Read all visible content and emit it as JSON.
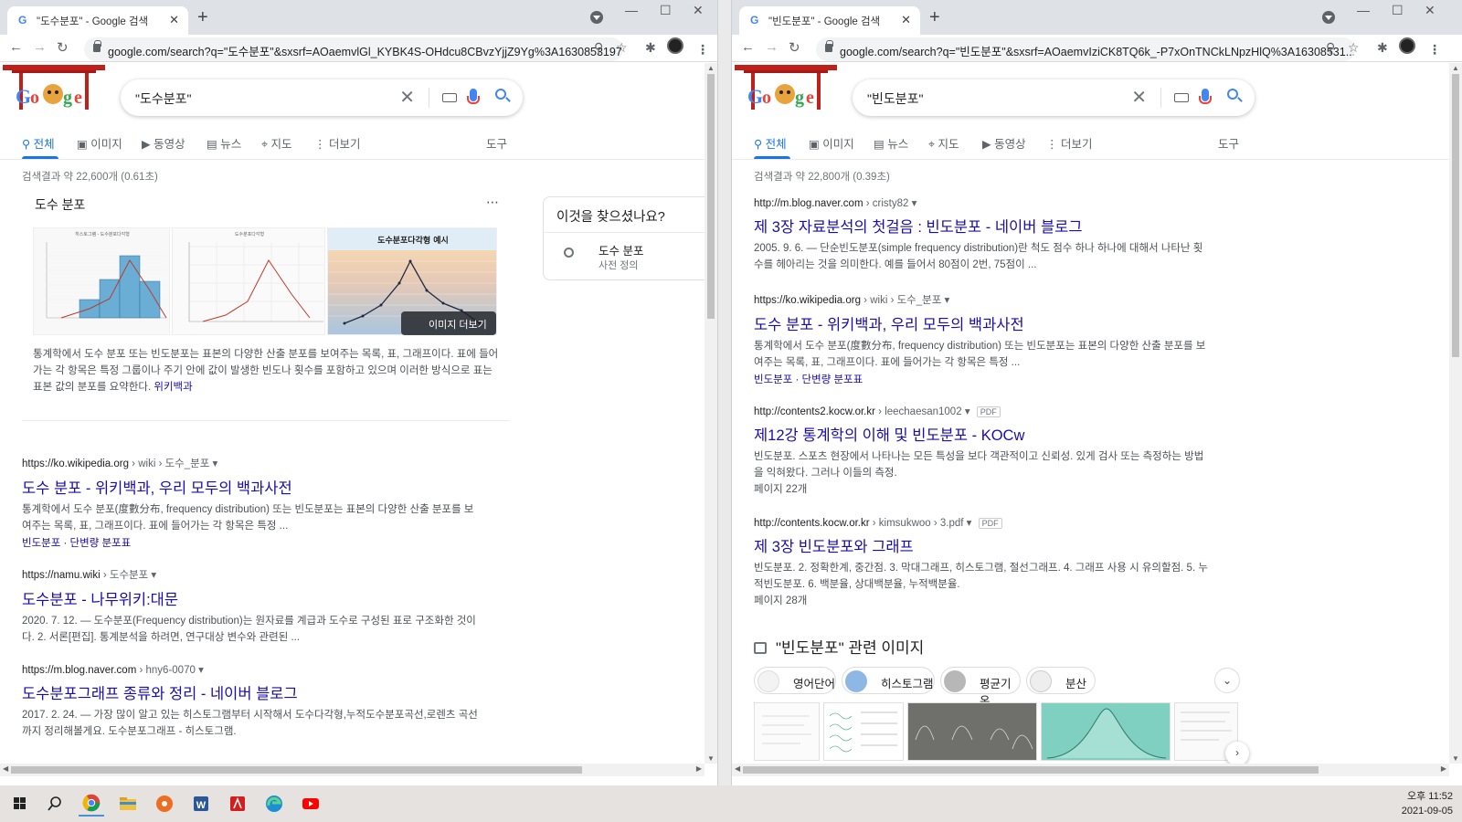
{
  "left": {
    "tab_title": "\"도수분포\" - Google 검색",
    "url": "google.com/search?q=\"도수분포\"&sxsrf=AOaemvlGl_KYBK4S-OHdcu8CBvzYjjZ9Yg%3A1630853197...",
    "query": "\"도수분포\"",
    "tabs": [
      "전체",
      "이미지",
      "동영상",
      "뉴스",
      "지도",
      "더보기"
    ],
    "tools": "도구",
    "stats": "검색결과 약 22,600개 (0.61초)",
    "kp": {
      "title": "도수 분포",
      "more_images": "이미지 더보기",
      "image1_caption": "히스토그램 - 도수분포다각형",
      "image2_caption": "도수분포다각형",
      "image3_caption": "도수분포다각형 예시",
      "description": "통계학에서 도수 분포 또는 빈도분포는 표본의 다양한 산출 분포를 보여주는 목록, 표, 그래프이다. 표에 들어가는 각 항목은 특정 그룹이나 주기 안에 값이 발생한 빈도나 횟수를 포함하고 있으며 이러한 방식으로 표는 표본 값의 분포를 요약한다.",
      "source": "위키백과"
    },
    "side": {
      "heading": "이것을 찾으셨나요?",
      "term": "도수 분포",
      "sub": "사전 정의"
    },
    "results": [
      {
        "site": "https://ko.wikipedia.org",
        "path": " › wiki › 도수_분포",
        "title": "도수 분포 - 위키백과, 우리 모두의 백과사전",
        "snippet": "통계학에서 도수 분포(度數分布, frequency distribution) 또는 빈도분포는 표본의 다양한 산출 분포를 보여주는 목록, 표, 그래프이다. 표에 들어가는 각 항목은 특정 ...",
        "links": "빈도분포 · 단변량 분포표"
      },
      {
        "site": "https://namu.wiki",
        "path": " › 도수분포",
        "title": "도수분포 - 나무위키:대문",
        "snippet": "2020. 7. 12. — 도수분포(Frequency distribution)는 원자료를 계급과 도수로 구성된 표로 구조화한 것이다. 2. 서론[편집]. 통계분석을 하려면, 연구대상 변수와 관련된 ...",
        "links": ""
      },
      {
        "site": "https://m.blog.naver.com",
        "path": " › hny6-0070",
        "title": "도수분포그래프 종류와 정리 - 네이버 블로그",
        "snippet": "2017. 2. 24. — 가장 많이 알고 있는 히스토그램부터 시작해서 도수다각형,누적도수분포곡선,로렌츠 곡선까지 정리해볼게요. 도수분포그래프 - 히스토그램.",
        "links": ""
      }
    ]
  },
  "right": {
    "tab_title": "\"빈도분포\" - Google 검색",
    "url": "google.com/search?q=\"빈도분포\"&sxsrf=AOaemvIziCK8TQ6k_-P7xOnTNCkLNpzHlQ%3A16308531...",
    "query": "\"빈도분포\"",
    "tabs": [
      "전체",
      "이미지",
      "뉴스",
      "지도",
      "동영상",
      "더보기"
    ],
    "tools": "도구",
    "stats": "검색결과 약 22,800개 (0.39초)",
    "results": [
      {
        "site": "http://m.blog.naver.com",
        "path": " › cristy82",
        "title": "제 3장 자료분석의 첫걸음 : 빈도분포 - 네이버 블로그",
        "snippet": "2005. 9. 6. — 단순빈도분포(simple frequency distribution)란 척도 점수 하나 하나에 대해서 나타난 횟수를 헤아리는 것을 의미한다. 예를 들어서 80점이 2번, 75점이 ...",
        "links": "",
        "pdf": "",
        "pages": ""
      },
      {
        "site": "https://ko.wikipedia.org",
        "path": " › wiki › 도수_분포",
        "title": "도수 분포 - 위키백과, 우리 모두의 백과사전",
        "snippet": "통계학에서 도수 분포(度數分布, frequency distribution) 또는 빈도분포는 표본의 다양한 산출 분포를 보여주는 목록, 표, 그래프이다. 표에 들어가는 각 항목은 특정 ...",
        "links": "빈도분포 · 단변량 분포표",
        "pdf": "",
        "pages": ""
      },
      {
        "site": "http://contents2.kocw.or.kr",
        "path": " › leechaesan1002",
        "title": "제12강 통계학의 이해 및 빈도분포 - KOCw",
        "snippet": "빈도분포. 스포츠 현장에서 나타나는 모든 특성을 보다 객관적이고 신뢰성. 있게 검사 또는 측정하는 방법을 익혀왔다. 그러나 이들의 측정.",
        "links": "",
        "pdf": "PDF",
        "pages": "페이지 22개"
      },
      {
        "site": "http://contents.kocw.or.kr",
        "path": " › kimsukwoo › 3.pdf",
        "title": "제 3장 빈도분포와 그래프",
        "snippet": "빈도분포. 2. 정확한계, 중간점. 3. 막대그래프, 히스토그램, 절선그래프. 4. 그래프 사용 시 유의할점. 5. 누적빈도분포. 6. 백분율, 상대백분율, 누적백분율.",
        "links": "",
        "pdf": "PDF",
        "pages": "페이지 28개"
      }
    ],
    "related_title": "\"빈도분포\" 관련 이미지",
    "chips": [
      "영어단어",
      "히스토그램",
      "평균기온",
      "분산"
    ]
  },
  "clock": {
    "time": "오후 11:52",
    "date": "2021-09-05"
  }
}
